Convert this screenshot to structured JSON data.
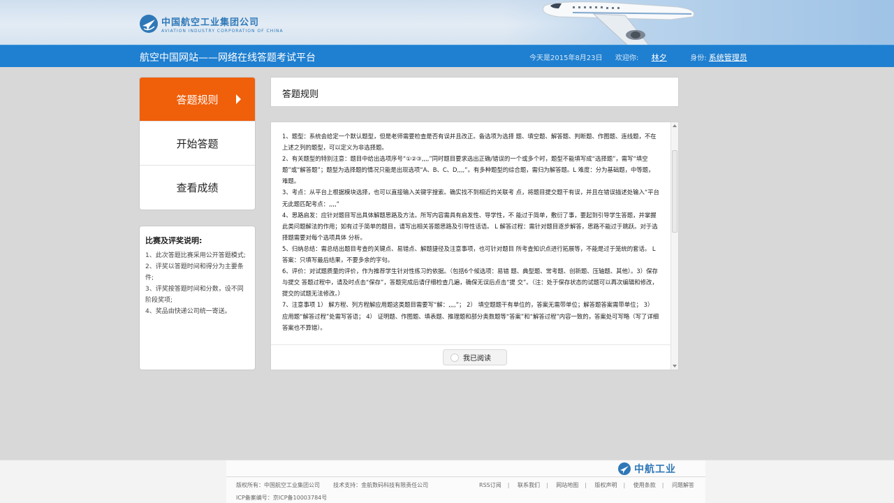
{
  "header": {
    "logo_cn": "中国航空工业集团公司",
    "logo_en": "AVIATION INDUSTRY CORPORATION OF CHINA",
    "site_title": "航空中国网站——网络在线答题考试平台",
    "date_text": "今天是2015年8月23日",
    "welcome_label": "欢迎你:",
    "username": "林夕",
    "role_label": "身份:",
    "role": "系统管理员"
  },
  "menu": {
    "items": [
      {
        "label": "答题规则"
      },
      {
        "label": "开始答题"
      },
      {
        "label": "查看成绩"
      }
    ]
  },
  "prize": {
    "title": "比赛及评奖说明:",
    "items": [
      "1、此次答题比赛采用公开答题模式;",
      "2、评奖以答题时间和得分为主要条件;",
      "3、评奖按答题时间和分数，设不同阶段奖项;",
      "4、奖品由快递公司统一寄送。"
    ]
  },
  "rules": {
    "header_title": "答题规则",
    "paragraphs": [
      "1、题型：系统会给定一个默认题型，但是老师需要检查是否有误并且改正。备选项为选择 题、填空题、解答题、判断题、作图题、连线题，不在上述之列的题型，可以定义为非选择题。",
      "2、有关题型的特别注意：题目中给出选项序号“①②③,,,,”同时题目要求选出正确/错误的一个或多个时，题型不能填写成“选择题”，需写“填空题”或“解答题”；题型为选择题的情况只能是出现选项“A、B、C、D,,,,”。有多种题型的综合题，需归为解答题。L 难度：分为基础题，中等题，难题。",
      "3、考点：从平台上根据模块选择，也可以直接输入关键字搜索。确实找不到相近的关联考 点，将题目提交题干有误，并且在错误描述处输入“平台无此题匹配考点：,,,,”",
      "4、思路启发：应针对题目写出具体解题思路及方法。所写内容需具有启发性、导学性，不 能过于简单，敷衍了事，要起到引导学生答题，并掌握此类问题解法的作用；如有过于简单的题目，请写出相关答题思路及引导性话语。 L 解答过程：需针对题目逐步解答，思路不能过于跳跃。对于选择题需要对每个选项具体 分析。",
      "5、归纳总结：需总结出题目考查的关键点、易错点、解题捷径及注意事项，也可针对题目 所考查知识点进行拓展等，不能是过于笼统的套话。 L 答案：只填写最后结果，不要多余的字句。",
      "6、评价：对试题质量的评价，作为推荐学生针对性练习的依据。（包括6个候选项：易错 题、典型题、常考题、创新题、压轴题、其他）。3）保存与提交 答题过程中，请及时点击“保存”，答题完成后请仔细检查几遍，确保无误后点击“提 交”。（注：处于保存状态的试题可以再次编辑和修改，提交的试题无法修改。）",
      "7、注意事项 1） 解方程、列方程解应用题这类题目需要写“解：,,,,”； 2） 填空题题干有单位的，答案无需带单位；解答题答案需带单位； 3） 应用题“解答过程”处需写答语； 4） 证明题、作图题、填表题、推理题和部分奥数题等“答案”和“解答过程”内容一致的，答案处可写略（写了详细答案也不算错）。"
    ],
    "read_label": "我已阅读"
  },
  "footer": {
    "logo_text": "中航工业",
    "copyright": "版权所有：中国航空工业集团公司",
    "tech_support": "技术支持：金航数码科技有限责任公司",
    "icp": "ICP备案编号：京ICP备10003784号",
    "links": [
      "RSS订阅",
      "联系我们",
      "网站地图",
      "版权声明",
      "使用条款",
      "问题解答"
    ]
  },
  "colors": {
    "nav_blue": "#1f7fd0",
    "active_orange": "#f05f0a",
    "brand_blue": "#2f78b8"
  },
  "icons": [
    "aviation-logo-icon",
    "airplane-image",
    "chevron-right-icon",
    "radio-icon",
    "scroll-up-icon",
    "scroll-down-icon"
  ]
}
